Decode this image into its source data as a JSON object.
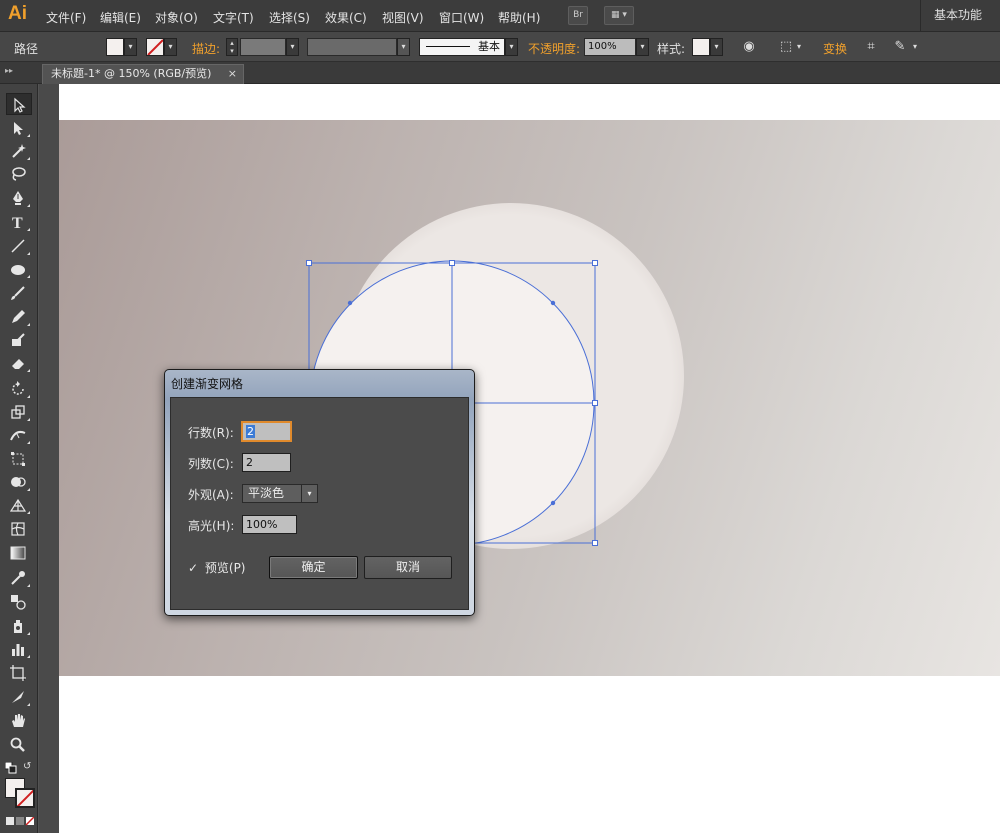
{
  "app": {
    "logo": "Ai",
    "workspace": "基本功能"
  },
  "menu": [
    "文件(F)",
    "编辑(E)",
    "对象(O)",
    "文字(T)",
    "选择(S)",
    "效果(C)",
    "视图(V)",
    "窗口(W)",
    "帮助(H)"
  ],
  "menubar_buttons": {
    "bridge": "Br",
    "arrange": "▦ ▾"
  },
  "control_bar": {
    "object_type": "路径",
    "stroke_label": "描边:",
    "stroke_profile": "基本",
    "opacity_label": "不透明度:",
    "opacity_value": "100%",
    "style_label": "样式:",
    "transform_label": "变换"
  },
  "tab": {
    "title": "未标题-1* @ 150% (RGB/预览)",
    "close": "×"
  },
  "dialog": {
    "title": "创建渐变网格",
    "rows_label": "行数(R):",
    "rows_value": "2",
    "cols_label": "列数(C):",
    "cols_value": "2",
    "appearance_label": "外观(A):",
    "appearance_value": "平淡色",
    "highlight_label": "高光(H):",
    "highlight_value": "100%",
    "preview_label": "预览(P)",
    "preview_checked": "✓",
    "ok_label": "确定",
    "cancel_label": "取消"
  },
  "colors": {
    "accent": "#f0a02c",
    "selection": "#4a6fd6",
    "fill": "#f4f0ee",
    "halo": "#ebe6e3"
  }
}
